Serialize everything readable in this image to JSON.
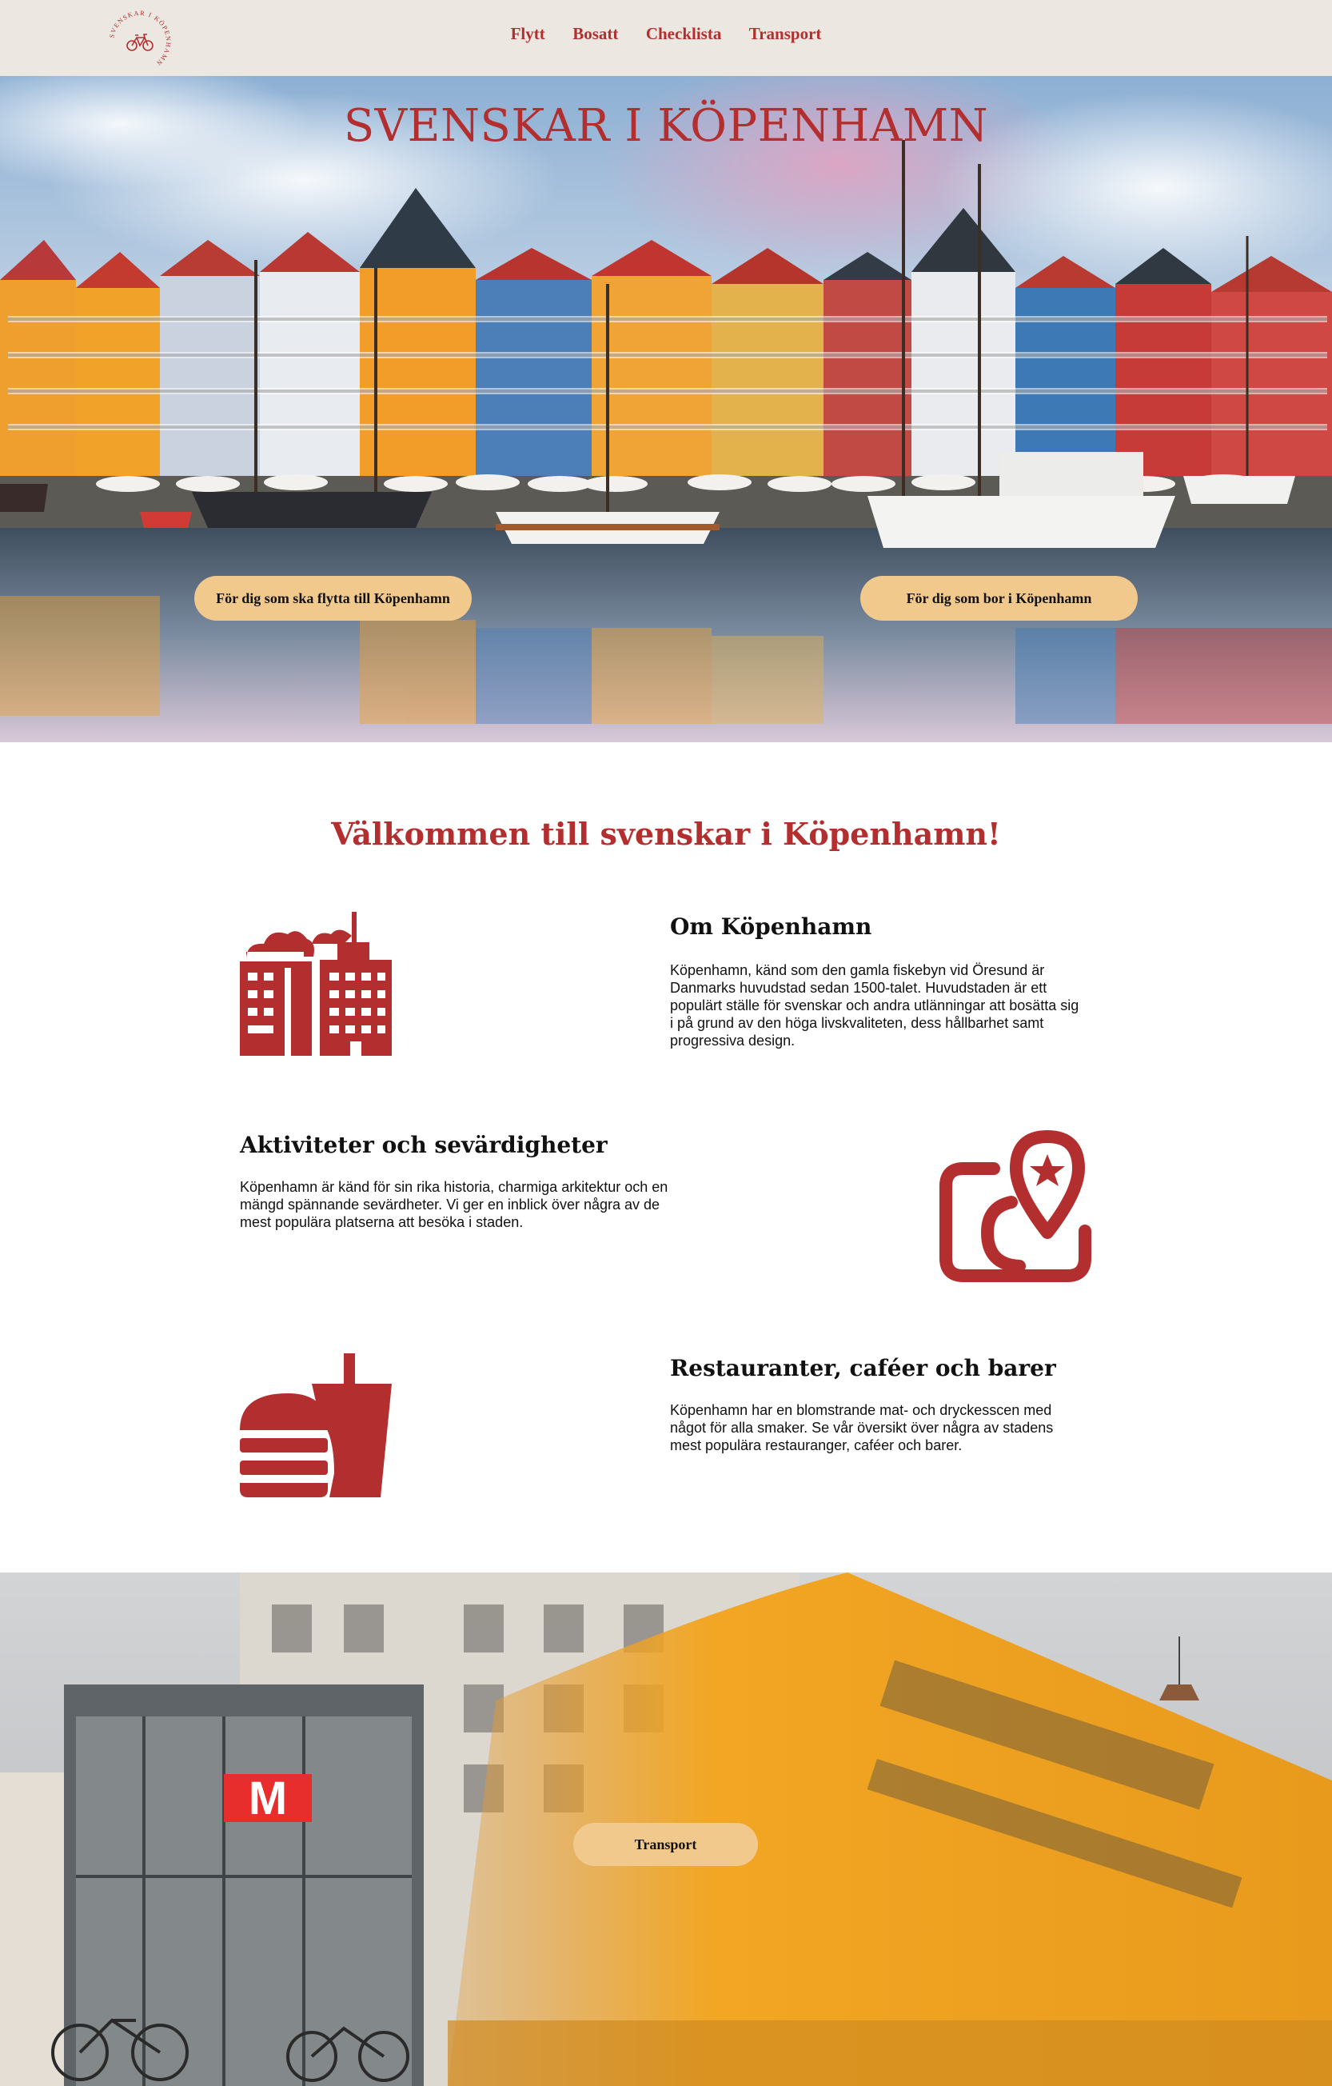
{
  "logo": {
    "ring_text": "SVENSKAR I KÖPENHAMN",
    "icon": "bicycle-icon"
  },
  "nav": {
    "items": [
      "Flytt",
      "Bosatt",
      "Checklista",
      "Transport"
    ]
  },
  "hero": {
    "title": "SVENSKAR I KÖPENHAMN",
    "button_move": "För dig som ska flytta till Köpenhamn",
    "button_live": "För dig som bor i Köpenhamn"
  },
  "welcome": {
    "title": "Välkommen till svenskar i Köpenhamn!"
  },
  "sections": [
    {
      "heading": "Om Köpenhamn",
      "text": "Köpenhamn, känd som den gamla fiskebyn vid Öresund är Danmarks huvudstad sedan 1500-talet. Huvudstaden är ett populärt ställe för svenskar och andra utlänningar att bosätta sig i på grund av den höga livskvaliteten, dess hållbarhet samt progressiva design.",
      "icon": "city-buildings-icon"
    },
    {
      "heading": "Aktiviteter och sevärdigheter",
      "text": "Köpenhamn är känd för sin rika historia, charmiga arkitektur och en mängd spännande sevärdheter. Vi ger en inblick över några av de mest populära platserna att besöka i staden.",
      "icon": "map-pin-star-icon"
    },
    {
      "heading": "Restauranter, caféer och barer",
      "text": "Köpenhamn har en blomstrande mat- och dryckesscen med något för alla smaker. Se vår översikt över några av stadens mest populära restauranger, caféer och barer.",
      "icon": "burger-drink-icon"
    }
  ],
  "transport": {
    "button": "Transport",
    "metro_sign": "M"
  },
  "colors": {
    "accent": "#B32E2E",
    "header_bg": "#ECE8E1",
    "button_bg": "#F2C98C",
    "text": "#111111"
  }
}
